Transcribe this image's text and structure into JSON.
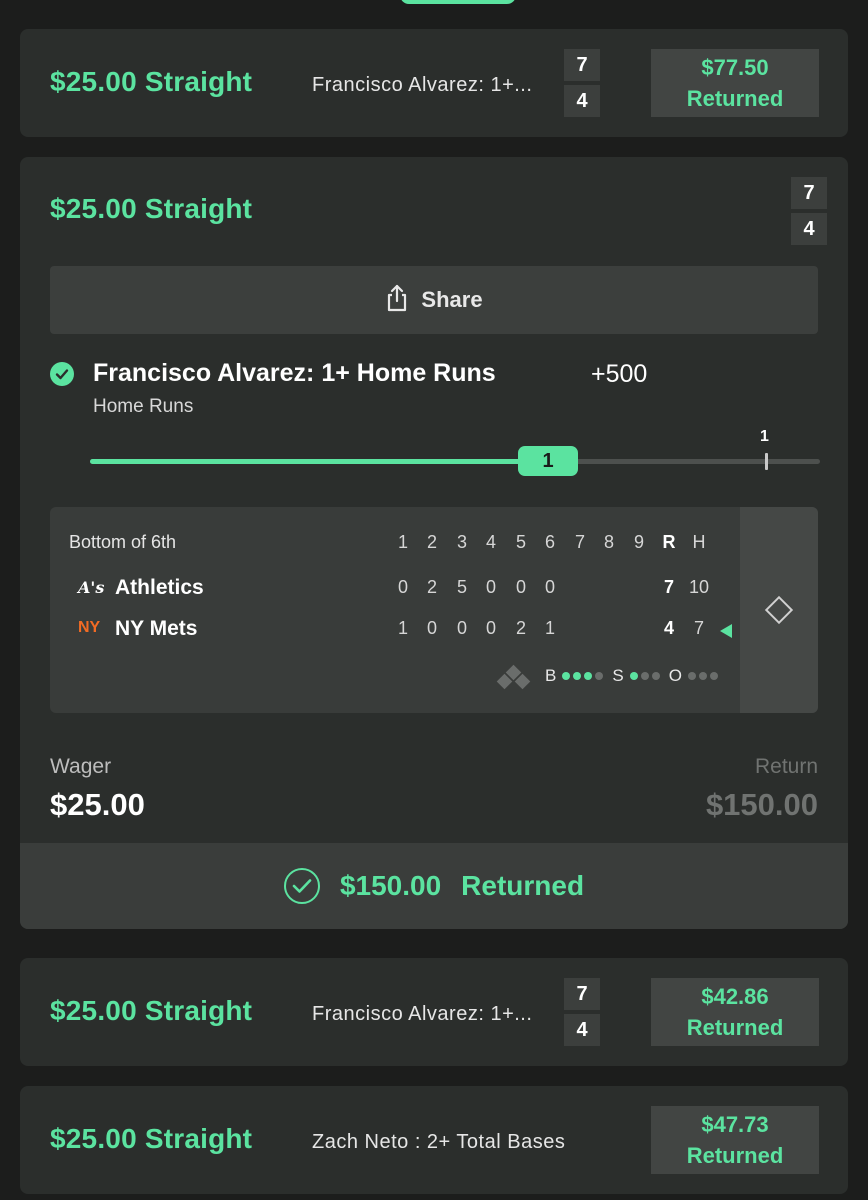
{
  "bets": [
    {
      "title": "$25.00 Straight",
      "leg_desc": "Francisco Alvarez: 1+...",
      "score_top": "7",
      "score_bottom": "4",
      "returned_amount": "$77.50",
      "returned_label": "Returned"
    },
    {
      "title": "$25.00 Straight",
      "score_top": "7",
      "score_bottom": "4",
      "share_label": "Share",
      "leg_title": "Francisco Alvarez: 1+ Home Runs",
      "leg_odds": "+500",
      "leg_market": "Home Runs",
      "progress": {
        "current": "1",
        "target": "1",
        "fraction": 1.0
      },
      "scoreboard": {
        "inning": "Bottom of 6th",
        "headers": [
          "1",
          "2",
          "3",
          "4",
          "5",
          "6",
          "7",
          "8",
          "9",
          "R",
          "H"
        ],
        "teams": [
          {
            "logo": "A's",
            "name": "Athletics",
            "innings": [
              "0",
              "2",
              "5",
              "0",
              "0",
              "0",
              "",
              "",
              ""
            ],
            "R": "7",
            "H": "10",
            "logo_color": "#ffffff"
          },
          {
            "logo": "NY",
            "name": "NY Mets",
            "innings": [
              "1",
              "0",
              "0",
              "0",
              "2",
              "1",
              "",
              "",
              ""
            ],
            "R": "4",
            "H": "7",
            "logo_color": "#f26b24"
          }
        ],
        "count": {
          "balls_label": "B",
          "strikes_label": "S",
          "outs_label": "O",
          "balls": 3,
          "strikes": 1,
          "outs": 0
        }
      },
      "wager_label": "Wager",
      "wager_value": "$25.00",
      "return_label": "Return",
      "return_value": "$150.00",
      "returned_amount": "$150.00",
      "returned_label": "Returned"
    },
    {
      "title": "$25.00 Straight",
      "leg_desc": "Francisco Alvarez: 1+...",
      "score_top": "7",
      "score_bottom": "4",
      "returned_amount": "$42.86",
      "returned_label": "Returned"
    },
    {
      "title": "$25.00 Straight",
      "leg_desc": "Zach Neto : 2+ Total Bases",
      "returned_amount": "$47.73",
      "returned_label": "Returned"
    }
  ],
  "colors": {
    "accent": "#5be3a0",
    "card": "#2b2e2c",
    "bg": "#1c1d1c"
  },
  "icons": {
    "share": "share-icon",
    "check": "check-circle-icon",
    "diamond": "diamond-icon"
  }
}
